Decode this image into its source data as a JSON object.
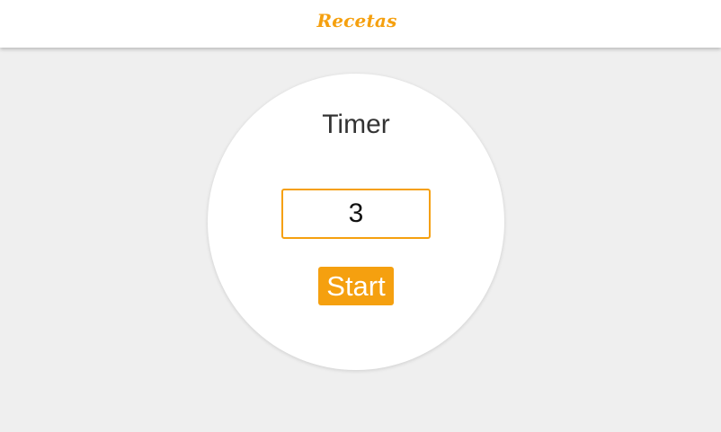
{
  "header": {
    "brand_title": "Recetas",
    "brand_color": "#f5a00f"
  },
  "timer": {
    "title": "Timer",
    "input_value": "3",
    "start_label": "Start",
    "accent_color": "#f5a00f"
  }
}
